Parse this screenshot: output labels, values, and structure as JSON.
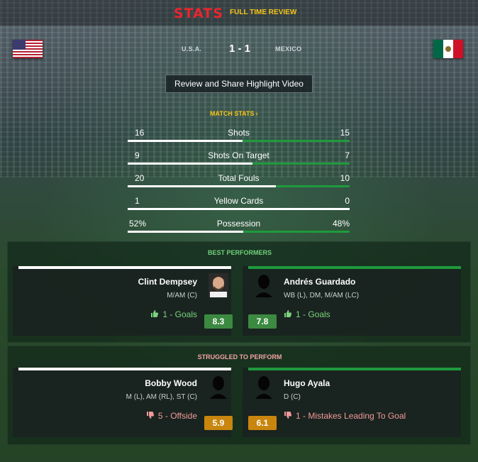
{
  "header": {
    "title": "STATS",
    "subtitle": "FULL TIME REVIEW"
  },
  "match": {
    "home_team": "U.S.A.",
    "away_team": "MEXICO",
    "score": "1 - 1",
    "home_flag": "usa-flag",
    "away_flag": "mexico-flag"
  },
  "review_button": "Review and Share Highlight Video",
  "match_stats_link": "MATCH STATS",
  "stats": [
    {
      "label": "Shots",
      "home": "16",
      "away": "15",
      "home_share": 0.516
    },
    {
      "label": "Shots On Target",
      "home": "9",
      "away": "7",
      "home_share": 0.5625
    },
    {
      "label": "Total Fouls",
      "home": "20",
      "away": "10",
      "home_share": 0.667
    },
    {
      "label": "Yellow Cards",
      "home": "1",
      "away": "0",
      "home_share": 1.0
    },
    {
      "label": "Possession",
      "home": "52%",
      "away": "48%",
      "home_share": 0.52
    }
  ],
  "best_performers": {
    "title": "BEST PERFORMERS",
    "home": {
      "name": "Clint Dempsey",
      "position": "M/AM (C)",
      "detail": "1 - Goals",
      "rating": "8.3"
    },
    "away": {
      "name": "Andrés Guardado",
      "position": "WB (L), DM, M/AM (LC)",
      "detail": "1 - Goals",
      "rating": "7.8"
    }
  },
  "struggled": {
    "title": "STRUGGLED TO PERFORM",
    "home": {
      "name": "Bobby Wood",
      "position": "M (L), AM (RL), ST (C)",
      "detail": "5 - Offside",
      "rating": "5.9"
    },
    "away": {
      "name": "Hugo Ayala",
      "position": "D (C)",
      "detail": "1 - Mistakes Leading To Goal",
      "rating": "6.1"
    }
  },
  "colors": {
    "title_red": "#e8262e",
    "accent_yellow": "#f6c419",
    "home_bar": "#ffffff",
    "away_bar": "#1f9a3c",
    "good_text": "#7dd37e",
    "bad_text": "#f19a9a",
    "rating_good": "#3c8a41",
    "rating_bad": "#c9860e"
  }
}
